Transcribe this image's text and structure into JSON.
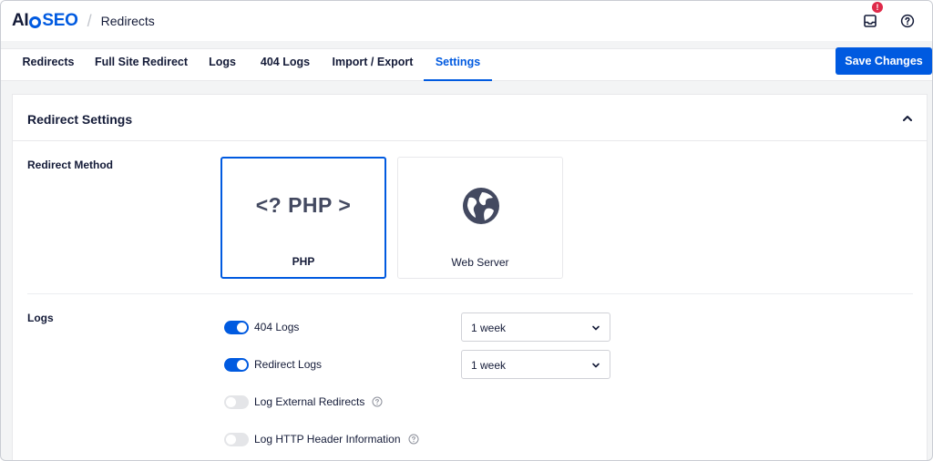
{
  "header": {
    "logo": {
      "prefix": "AI",
      "o": "O",
      "suffix": "SEO"
    },
    "separator": "/",
    "breadcrumb": "Redirects",
    "notification_count": "!",
    "icons": [
      "inbox-icon",
      "help-circle-icon"
    ]
  },
  "tabs": [
    {
      "label": "Redirects",
      "active": false
    },
    {
      "label": "Full Site Redirect",
      "active": false
    },
    {
      "label": "Logs",
      "active": false
    },
    {
      "label": "404 Logs",
      "active": false
    },
    {
      "label": "Import / Export",
      "active": false
    },
    {
      "label": "Settings",
      "active": true
    }
  ],
  "save_button": "Save Changes",
  "card": {
    "title": "Redirect Settings",
    "collapse_icon": "chevron-up-icon"
  },
  "redirect_method": {
    "label": "Redirect Method",
    "options": [
      {
        "label": "PHP",
        "glyph": "<? PHP >",
        "selected": true
      },
      {
        "label": "Web Server",
        "icon": "globe-icon",
        "selected": false
      }
    ]
  },
  "logs": {
    "label": "Logs",
    "items": [
      {
        "label": "404 Logs",
        "enabled": true,
        "select_value": "1 week",
        "help": false
      },
      {
        "label": "Redirect Logs",
        "enabled": true,
        "select_value": "1 week",
        "help": false
      },
      {
        "label": "Log External Redirects",
        "enabled": false,
        "help": true
      },
      {
        "label": "Log HTTP Header Information",
        "enabled": false,
        "help": true
      }
    ]
  },
  "colors": {
    "accent": "#005ae0",
    "text": "#141b38",
    "badge": "#df2a4a"
  }
}
